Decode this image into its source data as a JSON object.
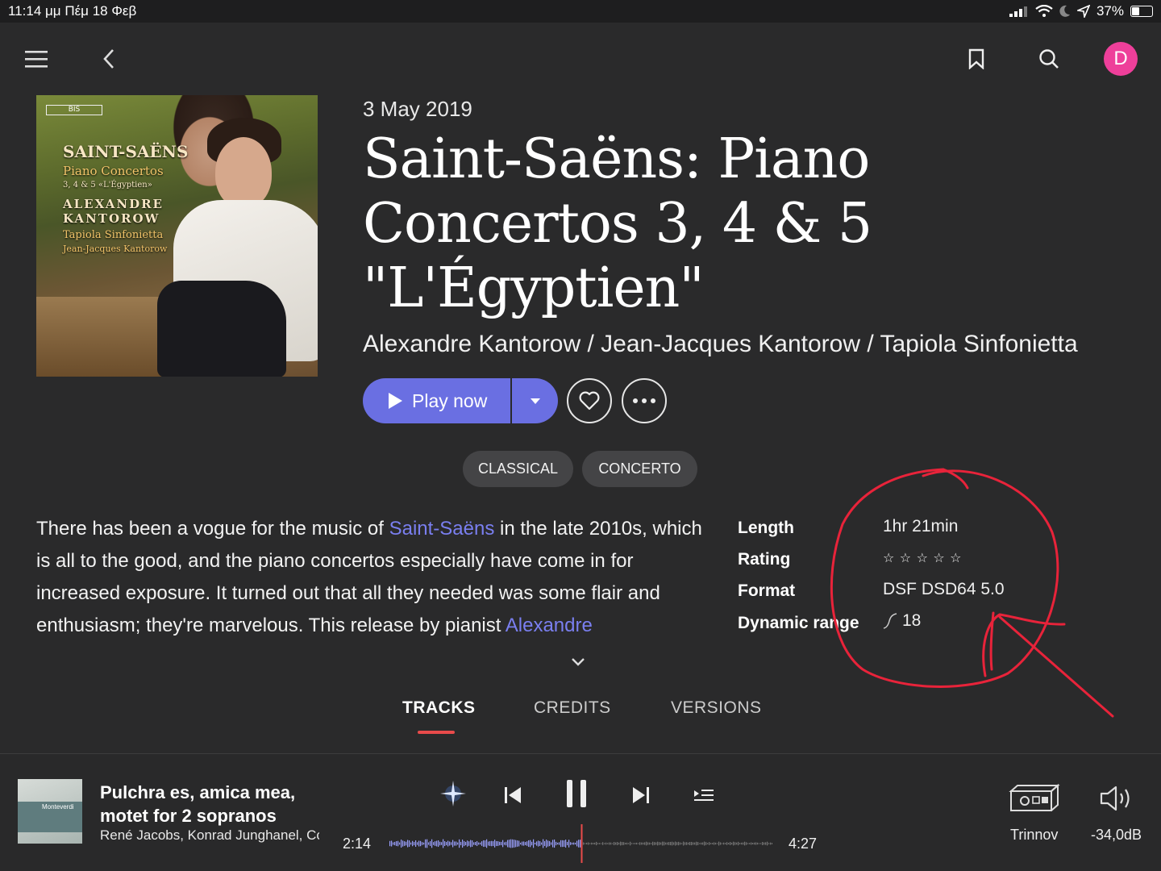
{
  "status_bar": {
    "time_date": "11:14 μμ   Πέμ 18 Φεβ",
    "battery": "37%",
    "battery_level": 0.37
  },
  "album": {
    "cover_text": {
      "label": "BIS",
      "composer": "SAINT-SAËNS",
      "work": "Piano Concertos",
      "numbers": "3, 4 & 5 «L'Égyptien»",
      "artist_line1": "ALEXANDRE",
      "artist_line2": "KANTOROW",
      "ensemble": "Tapiola Sinfonietta",
      "conductor": "Jean-Jacques Kantorow"
    },
    "date": "3 May 2019",
    "title": "Saint-Saëns: Piano Concertos 3, 4 & 5 \"L'Égyptien\"",
    "artists": "Alexandre Kantorow / Jean-Jacques Kantorow / Tapiola Sinfonietta",
    "play_label": "Play now",
    "tags": [
      "CLASSICAL",
      "CONCERTO"
    ],
    "description": {
      "part1": "There has been a vogue for the music of ",
      "link1": "Saint-Saëns",
      "part2": " in the late 2010s, which is all to the good, and the piano concertos especially have come in for increased exposure. It turned out that all they needed was some flair and enthusiasm; they're marvelous. This release by pianist ",
      "link2": "Alexandre"
    },
    "meta": {
      "length_label": "Length",
      "length": "1hr 21min",
      "rating_label": "Rating",
      "rating_stars": "☆ ☆ ☆ ☆ ☆",
      "rating_value": 0,
      "format_label": "Format",
      "format": "DSF DSD64 5.0",
      "dr_label": "Dynamic range",
      "dr": "18"
    }
  },
  "tabs": {
    "tracks": "TRACKS",
    "credits": "CREDITS",
    "versions": "VERSIONS",
    "active": "TRACKS"
  },
  "accent_colors": {
    "primary": "#6a6fe2",
    "tab_underline": "#e94b4b",
    "avatar": "#ee3f9a",
    "annotation": "#e8233a"
  },
  "user": {
    "avatar_letter": "D"
  },
  "now_playing": {
    "cover_text": "Monteverdi",
    "title": "Pulchra es, amica mea, motet for 2 sopranos",
    "artist": "René Jacobs, Konrad Junghanel, Cc",
    "elapsed": "2:14",
    "total": "4:27",
    "progress": 0.5,
    "device": "Trinnov",
    "volume": "-34,0dB"
  }
}
